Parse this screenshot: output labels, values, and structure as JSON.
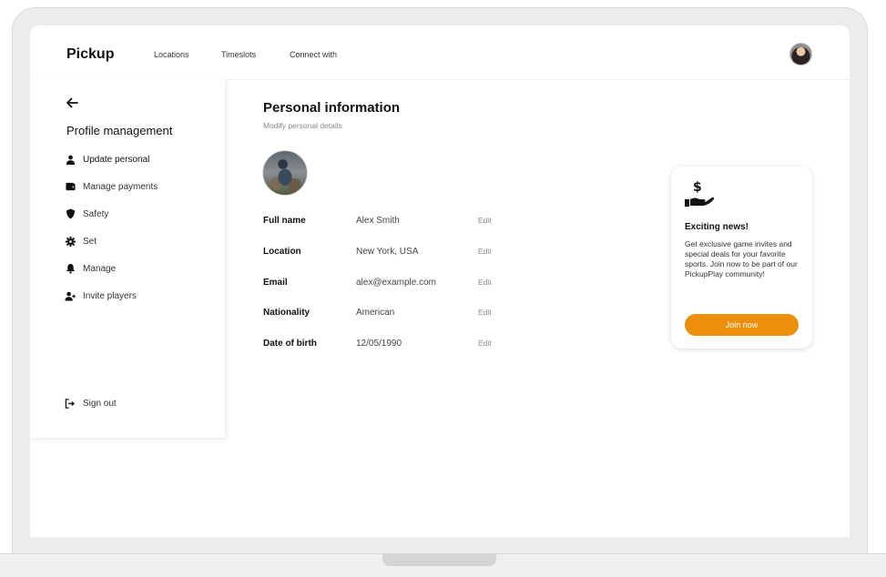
{
  "header": {
    "brand": "Pickup",
    "nav": [
      "Locations",
      "Timeslots",
      "Connect with"
    ]
  },
  "sidebar": {
    "title": "Profile management",
    "items": [
      {
        "label": "Update personal",
        "icon": "user-icon"
      },
      {
        "label": "Manage payments",
        "icon": "wallet-icon"
      },
      {
        "label": "Safety",
        "icon": "shield-icon"
      },
      {
        "label": "Set",
        "icon": "gear-icon"
      },
      {
        "label": "Manage",
        "icon": "bell-icon"
      },
      {
        "label": "Invite players",
        "icon": "user-plus-icon"
      }
    ],
    "signout": "Sign out"
  },
  "main": {
    "title": "Personal information",
    "subtitle": "Modify personal details",
    "edit_label": "Edit",
    "fields": [
      {
        "label": "Full name",
        "value": "Alex Smith"
      },
      {
        "label": "Location",
        "value": "New York, USA"
      },
      {
        "label": "Email",
        "value": "alex@example.com"
      },
      {
        "label": "Nationality",
        "value": "American"
      },
      {
        "label": "Date of birth",
        "value": "12/05/1990"
      }
    ]
  },
  "promo": {
    "title": "Exciting news!",
    "text": "Get exclusive game invites and special deals for your favorite sports. Join now to be part of our PickupPlay community!",
    "button": "Join now"
  },
  "colors": {
    "accent": "#ee8f0b",
    "background": "#ececec"
  }
}
